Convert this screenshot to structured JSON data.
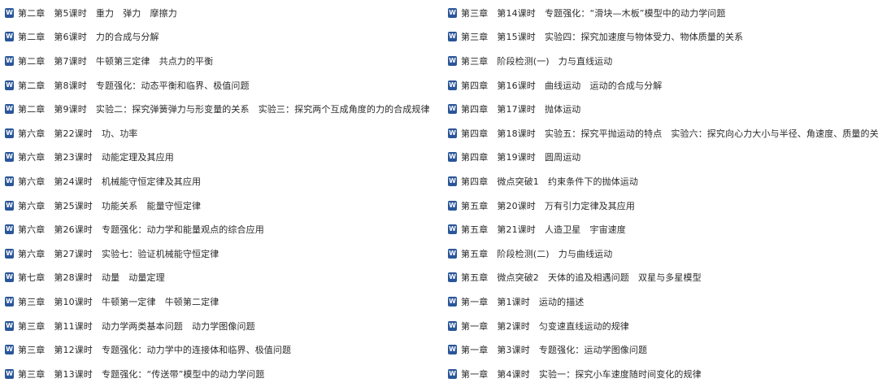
{
  "icon": "word-document-icon",
  "colors": {
    "word_icon": "#2a5699",
    "text": "#2b2b2b"
  },
  "left_column": [
    "第二章　第5课时　重力　弹力　摩擦力",
    "第二章　第6课时　力的合成与分解",
    "第二章　第7课时　牛顿第三定律　共点力的平衡",
    "第二章　第8课时　专题强化：动态平衡和临界、极值问题",
    "第二章　第9课时　实验二：探究弹簧弹力与形变量的关系　实验三：探究两个互成角度的力的合成规律",
    "第六章　第22课时　功、功率",
    "第六章　第23课时　动能定理及其应用",
    "第六章　第24课时　机械能守恒定律及其应用",
    "第六章　第25课时　功能关系　能量守恒定律",
    "第六章　第26课时　专题强化：动力学和能量观点的综合应用",
    "第六章　第27课时　实验七：验证机械能守恒定律",
    "第七章　第28课时　动量　动量定理",
    "第三章　第10课时　牛顿第一定律　牛顿第二定律",
    "第三章　第11课时　动力学两类基本问题　动力学图像问题",
    "第三章　第12课时　专题强化：动力学中的连接体和临界、极值问题",
    "第三章　第13课时　专题强化：“传送带”模型中的动力学问题"
  ],
  "right_column": [
    "第三章　第14课时　专题强化：“滑块—木板”模型中的动力学问题",
    "第三章　第15课时　实验四：探究加速度与物体受力、物体质量的关系",
    "第三章　阶段检测(一)　力与直线运动",
    "第四章　第16课时　曲线运动　运动的合成与分解",
    "第四章　第17课时　抛体运动",
    "第四章　第18课时　实验五：探究平抛运动的特点　实验六：探究向心力大小与半径、角速度、质量的关系",
    "第四章　第19课时　圆周运动",
    "第四章　微点突破1　约束条件下的抛体运动",
    "第五章　第20课时　万有引力定律及其应用",
    "第五章　第21课时　人造卫星　宇宙速度",
    "第五章　阶段检测(二)　力与曲线运动",
    "第五章　微点突破2　天体的追及相遇问题　双星与多星模型",
    "第一章　第1课时　运动的描述",
    "第一章　第2课时　匀变速直线运动的规律",
    "第一章　第3课时　专题强化：运动学图像问题",
    "第一章　第4课时　实验一：探究小车速度随时间变化的规律"
  ]
}
